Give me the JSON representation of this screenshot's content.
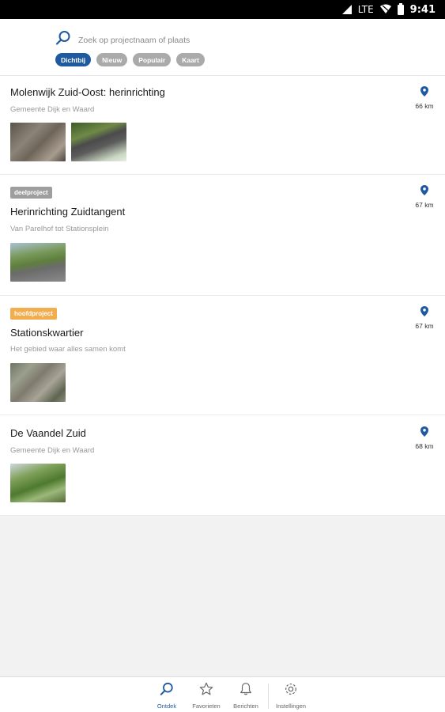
{
  "status_bar": {
    "network": "LTE",
    "time": "9:41"
  },
  "search": {
    "placeholder": "Zoek op projectnaam of plaats"
  },
  "filters": [
    {
      "label": "Dichtbij",
      "active": true
    },
    {
      "label": "Nieuw",
      "active": false
    },
    {
      "label": "Populair",
      "active": false
    },
    {
      "label": "Kaart",
      "active": false
    }
  ],
  "projects": [
    {
      "badge": "",
      "title": "Molenwijk Zuid-Oost: herinrichting",
      "subtitle": "Gemeente Dijk en Waard",
      "distance": "66 km",
      "photo_count": 2
    },
    {
      "badge": "deelproject",
      "title": "Herinrichting Zuidtangent",
      "subtitle": "Van Parelhof tot Stationsplein",
      "distance": "67 km",
      "photo_count": 1
    },
    {
      "badge": "hoofdproject",
      "title": "Stationskwartier",
      "subtitle": "Het gebied waar alles samen komt",
      "distance": "67 km",
      "photo_count": 1
    },
    {
      "badge": "",
      "title": "De Vaandel Zuid",
      "subtitle": "Gemeente Dijk en Waard",
      "distance": "68 km",
      "photo_count": 1
    }
  ],
  "tabs": [
    {
      "label": "Ontdek",
      "active": true
    },
    {
      "label": "Favorieten",
      "active": false
    },
    {
      "label": "Berichten",
      "active": false
    },
    {
      "label": "Instellingen",
      "active": false
    }
  ],
  "colors": {
    "accent": "#1f5aa0",
    "chip_inactive": "#aaaaaa",
    "badge_deelproject": "#9e9e9e",
    "badge_hoofdproject": "#f2ad4e"
  }
}
